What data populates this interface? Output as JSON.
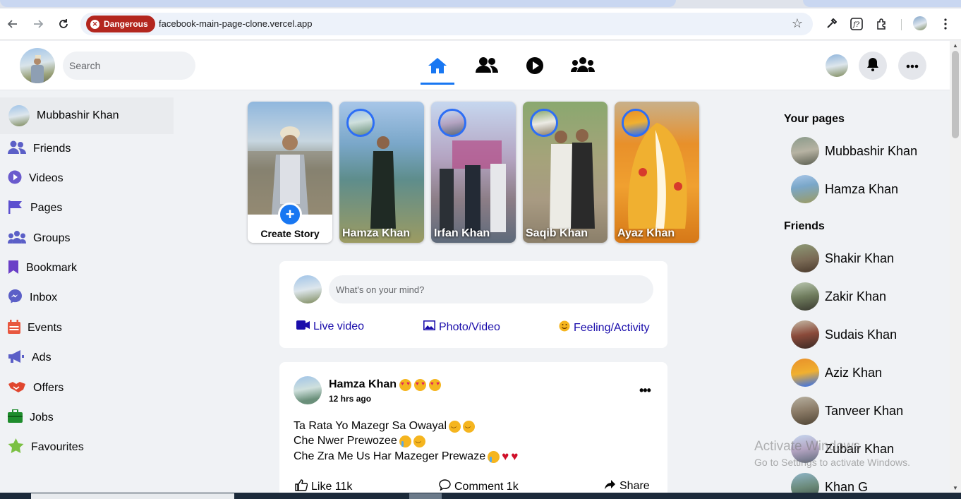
{
  "browser": {
    "security_label": "Dangerous",
    "url": "facebook-main-page-clone.vercel.app"
  },
  "header": {
    "search_placeholder": "Search",
    "nav_tabs": [
      {
        "name": "home-icon",
        "active": true
      },
      {
        "name": "friends-icon",
        "active": false
      },
      {
        "name": "watch-icon",
        "active": false
      },
      {
        "name": "groups-icon",
        "active": false
      }
    ],
    "accent_color": "#1877f2"
  },
  "sidebar": {
    "profile_name": "Mubbashir Khan",
    "items": [
      {
        "label": "Friends",
        "icon": "friends-icon",
        "color": "#5b5fc7"
      },
      {
        "label": "Videos",
        "icon": "play-icon",
        "color": "#6a5acd"
      },
      {
        "label": "Pages",
        "icon": "flag-icon",
        "color": "#5b4fcf"
      },
      {
        "label": "Groups",
        "icon": "groups-icon",
        "color": "#5b5fc7"
      },
      {
        "label": "Bookmark",
        "icon": "bookmark-icon",
        "color": "#6a3fc7"
      },
      {
        "label": "Inbox",
        "icon": "messenger-icon",
        "color": "#5b5fc7"
      },
      {
        "label": "Events",
        "icon": "calendar-icon",
        "color": "#e8573f"
      },
      {
        "label": "Ads",
        "icon": "megaphone-icon",
        "color": "#5b5fc7"
      },
      {
        "label": "Offers",
        "icon": "handshake-icon",
        "color": "#e0462e"
      },
      {
        "label": "Jobs",
        "icon": "briefcase-icon",
        "color": "#1e8c2c"
      },
      {
        "label": "Favourites",
        "icon": "star-icon",
        "color": "#7bc043"
      }
    ]
  },
  "stories": {
    "create_label": "Create Story",
    "items": [
      {
        "name": "Hamza Khan"
      },
      {
        "name": "Irfan Khan"
      },
      {
        "name": "Saqib Khan"
      },
      {
        "name": "Ayaz Khan"
      }
    ]
  },
  "composer": {
    "placeholder": "What's on your mind?",
    "actions": [
      {
        "label": "Live video",
        "icon": "video-camera-icon"
      },
      {
        "label": "Photo/Video",
        "icon": "image-icon"
      },
      {
        "label": "Feeling/Activity",
        "icon": "smile-icon"
      }
    ]
  },
  "post": {
    "author": "Hamza Khan",
    "time": "12 hrs ago",
    "lines": [
      "Ta Rata Yo Mazegr Sa Owayal",
      "Che Nwer Prewozee",
      "Che Zra Me Us Har Mazeger Prewaze"
    ],
    "like_label": "Like 11k",
    "comment_label": "Comment 1k",
    "share_label": "Share"
  },
  "right_sidebar": {
    "pages_title": "Your pages",
    "pages": [
      "Mubbashir Khan",
      "Hamza Khan"
    ],
    "friends_title": "Friends",
    "friends": [
      "Shakir Khan",
      "Zakir Khan",
      "Sudais Khan",
      "Aziz Khan",
      "Tanveer Khan",
      "Zubair Khan",
      "Khan G"
    ]
  },
  "watermark": {
    "line1": "Activate Windows",
    "line2": "Go to Settings to activate Windows."
  }
}
